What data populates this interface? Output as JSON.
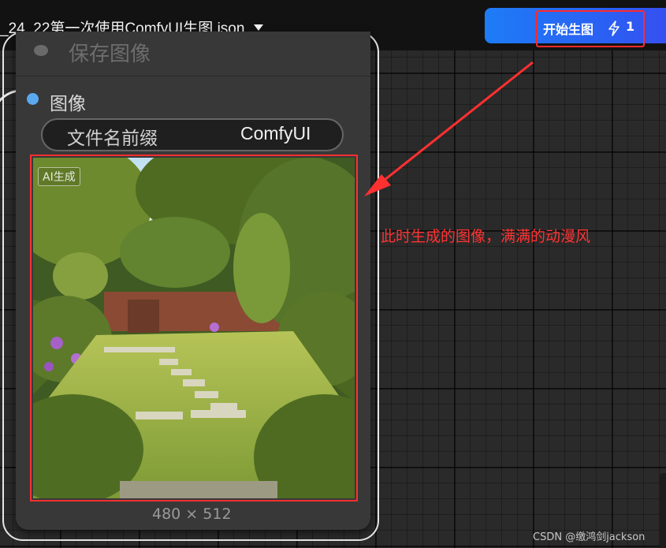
{
  "header": {
    "workflow_title": "_24_22第一次使用ComfyUI生图.json",
    "run_button_label": "开始生图",
    "run_count": "1"
  },
  "node": {
    "title": "保存图像",
    "output_label": "图像",
    "prefix_label": "文件名前缀",
    "prefix_value": "ComfyUI",
    "preview": {
      "badge": "AI生成",
      "dimensions": "480 × 512"
    }
  },
  "annotation": {
    "note": "此时生成的图像，满满的动漫风",
    "color": "#ff3333"
  },
  "watermark": "CSDN @缴鸿剑jackson",
  "colors": {
    "accent": "#1e7cf6",
    "highlight": "#ff2a2a",
    "output_dot": "#5aa8ef"
  },
  "icons": {
    "run": "lightning-bolt-icon",
    "dropdown": "triangle-down-icon"
  }
}
